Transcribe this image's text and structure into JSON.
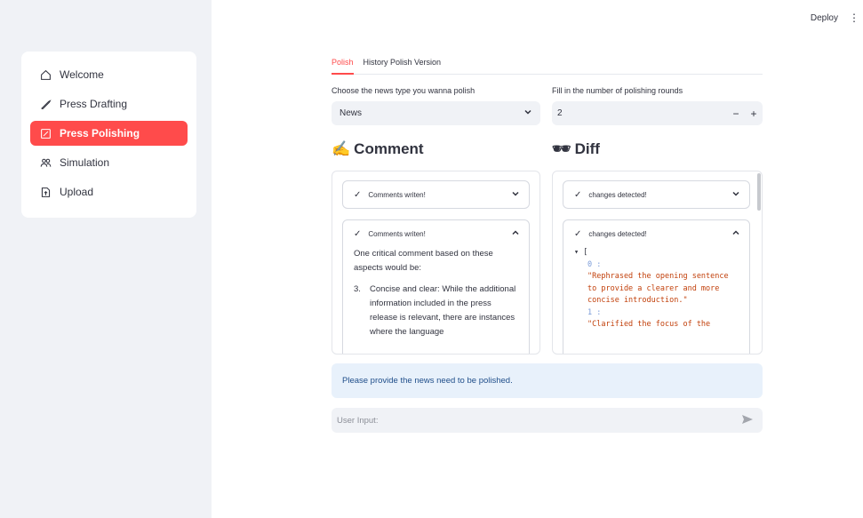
{
  "topbar": {
    "deploy_label": "Deploy",
    "menu_icon": "⋮"
  },
  "sidebar": {
    "items": [
      {
        "label": "Welcome",
        "icon": "home-icon"
      },
      {
        "label": "Press Drafting",
        "icon": "pen-icon"
      },
      {
        "label": "Press Polishing",
        "icon": "edit-box-icon",
        "active": true
      },
      {
        "label": "Simulation",
        "icon": "people-icon"
      },
      {
        "label": "Upload",
        "icon": "file-upload-icon"
      }
    ],
    "accent": "#ff4b4b"
  },
  "tabs": [
    {
      "label": "Polish",
      "active": true
    },
    {
      "label": "History Polish Version",
      "active": false
    }
  ],
  "form": {
    "news_type_label": "Choose the news type you wanna polish",
    "news_type_value": "News",
    "rounds_label": "Fill in the number of polishing rounds",
    "rounds_value": "2",
    "minus": "−",
    "plus": "+"
  },
  "comment": {
    "heading_emoji": "✍️",
    "heading": "Comment",
    "expander1_title": "Comments writen!",
    "expander2_title": "Comments writen!",
    "body_intro": "One critical comment based on these aspects would be:",
    "list_num": "3.",
    "list_text": "Concise and clear: While the additional information included in the press release is relevant, there are instances where the language"
  },
  "diff": {
    "heading_emoji": "🕶",
    "heading": "Diff",
    "expander1_title": "changes detected!",
    "expander2_title": "changes detected!",
    "json_open": "[",
    "idx0": "0 :",
    "str0": "\"Rephrased the opening sentence to provide a clearer and more concise introduction.\"",
    "idx1": "1 :",
    "str1_partial": "\"Clarified the focus of the"
  },
  "info": {
    "message": "Please provide the news need to be polished."
  },
  "chat": {
    "placeholder": "User Input:"
  }
}
